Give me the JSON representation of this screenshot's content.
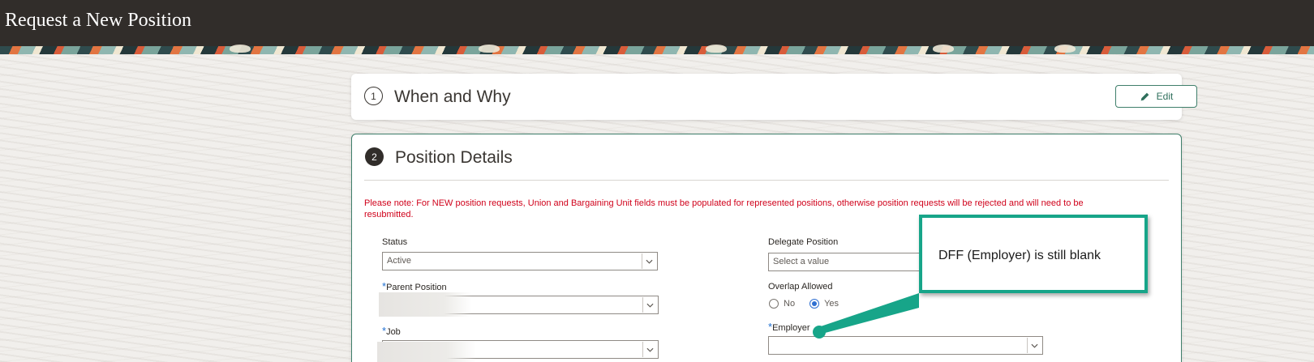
{
  "header": {
    "title": "Request a New Position"
  },
  "steps": [
    {
      "number": "1",
      "title": "When and Why",
      "edit_label": "Edit"
    },
    {
      "number": "2",
      "title": "Position Details"
    }
  ],
  "note": "Please note: For NEW position requests, Union and Bargaining Unit fields must be populated for represented positions, otherwise position requests will be rejected and will need to be resubmitted.",
  "fields": {
    "status": {
      "label": "Status",
      "value": "Active"
    },
    "parent_position": {
      "required": "*",
      "label": "Parent Position",
      "value": ""
    },
    "job": {
      "required": "*",
      "label": "Job",
      "value": ""
    },
    "delegate_position": {
      "label": "Delegate Position",
      "placeholder": "Select a value"
    },
    "overlap_allowed": {
      "label": "Overlap Allowed",
      "options": [
        "No",
        "Yes"
      ],
      "selected": "Yes"
    },
    "employer": {
      "required": "*",
      "label": "Employer",
      "value": ""
    }
  },
  "callout": {
    "text": "DFF (Employer) is still blank"
  },
  "colors": {
    "accent": "#3f7f6b",
    "callout_border": "#17a589",
    "note_red": "#d0021b",
    "header_bg": "#312d2a"
  }
}
